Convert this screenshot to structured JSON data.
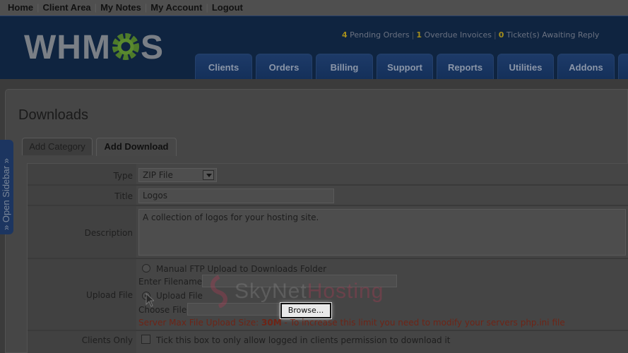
{
  "top_links": [
    "Home",
    "Client Area",
    "My Notes",
    "My Account",
    "Logout"
  ],
  "logo": {
    "prefix": "WHM",
    "suffix": "S"
  },
  "stats": {
    "pending_count": "4",
    "pending_label": "Pending Orders",
    "overdue_count": "1",
    "overdue_label": "Overdue Invoices",
    "tickets_count": "0",
    "tickets_label": "Ticket(s) Awaiting Reply"
  },
  "nav": [
    "Clients",
    "Orders",
    "Billing",
    "Support",
    "Reports",
    "Utilities",
    "Addons"
  ],
  "sidebar_label": "» Open Sidebar »",
  "page_title": "Downloads",
  "tabs": {
    "add_category": "Add Category",
    "add_download": "Add Download"
  },
  "form": {
    "type_label": "Type",
    "type_value": "ZIP File",
    "title_label": "Title",
    "title_value": "Logos",
    "description_label": "Description",
    "description_value": "A collection of logos for your hosting site.",
    "upload_label": "Upload File",
    "manual_ftp_label": "Manual FTP Upload to Downloads Folder",
    "enter_filename_label": "Enter Filename:",
    "upload_file_option": "Upload File",
    "choose_file_label": "Choose File:",
    "browse_label": "Browse...",
    "limit_prefix": "Server Max File Upload Size: ",
    "limit_value": "30M",
    "limit_suffix": " - To increase this limit you need to modify your servers php.ini file",
    "clients_only_label": "Clients Only",
    "clients_only_text": "Tick this box to only allow logged in clients permission to download it"
  },
  "watermark": {
    "part1": "SkyNet",
    "part2": "Hosting"
  },
  "colors": {
    "header_bg": "#0f2440",
    "nav_tab": "#1d3a68",
    "accent_num": "#a48d1c",
    "warning_text": "#6e2416"
  }
}
